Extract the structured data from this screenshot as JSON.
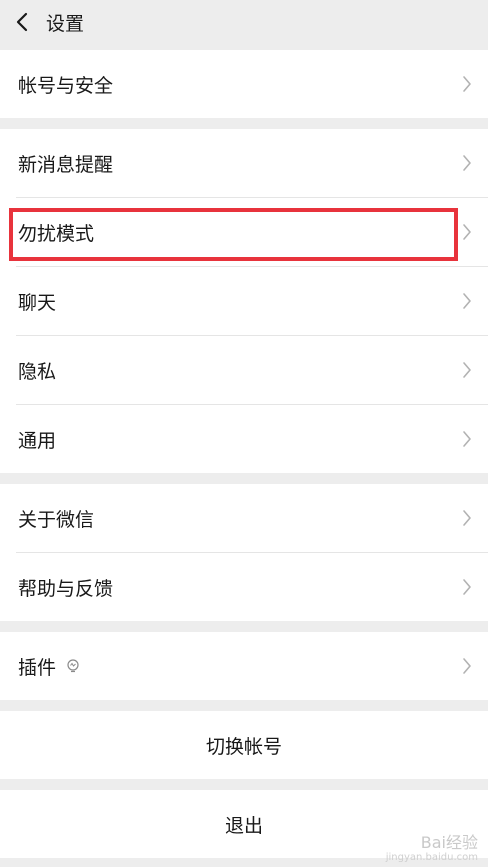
{
  "header": {
    "title": "设置",
    "back_icon": "chevron-left-icon"
  },
  "groups": [
    {
      "items": [
        {
          "label": "帐号与安全"
        }
      ]
    },
    {
      "items": [
        {
          "label": "新消息提醒"
        },
        {
          "label": "勿扰模式",
          "highlighted": true
        },
        {
          "label": "聊天"
        },
        {
          "label": "隐私"
        },
        {
          "label": "通用"
        }
      ]
    },
    {
      "items": [
        {
          "label": "关于微信"
        },
        {
          "label": "帮助与反馈"
        }
      ]
    },
    {
      "items": [
        {
          "label": "插件",
          "icon": "plugin-icon"
        }
      ]
    }
  ],
  "actions": {
    "switch_account": "切换帐号",
    "logout": "退出"
  },
  "watermark": {
    "text": "Bai经验",
    "sub": "jingyan.baidu.com"
  },
  "colors": {
    "background": "#ededed",
    "row_background": "#ffffff",
    "highlight_border": "#e8333c",
    "text": "#191919",
    "chevron": "#b2b2b2"
  }
}
